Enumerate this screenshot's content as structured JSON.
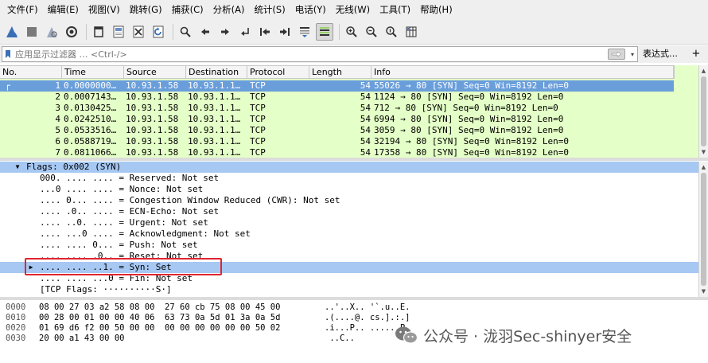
{
  "menu": [
    "文件(F)",
    "编辑(E)",
    "视图(V)",
    "跳转(G)",
    "捕获(C)",
    "分析(A)",
    "统计(S)",
    "电话(Y)",
    "无线(W)",
    "工具(T)",
    "帮助(H)"
  ],
  "toolbar": {
    "icons": [
      "shark-fin-start-icon",
      "stop-square-icon",
      "restart-fin-icon",
      "capture-options-gear-icon",
      "open-folder-icon",
      "save-file-icon",
      "close-file-icon",
      "reload-icon",
      "find-magnifier-icon",
      "go-back-arrow-icon",
      "go-forward-arrow-icon",
      "go-to-packet-icon",
      "go-first-packet-icon",
      "go-last-packet-icon",
      "autoscroll-icon",
      "colorize-icon",
      "zoom-in-icon",
      "zoom-out-icon",
      "zoom-normal-icon",
      "resize-columns-icon"
    ]
  },
  "filter": {
    "placeholder": "应用显示过滤器 … <Ctrl-/>",
    "expression_label": "表达式…",
    "plus_label": "+"
  },
  "packet_list": {
    "columns": [
      "No.",
      "Time",
      "Source",
      "Destination",
      "Protocol",
      "Length",
      "Info"
    ],
    "rows": [
      {
        "no": "1",
        "time": "0.0000000…",
        "src": "10.93.1.58",
        "dst": "10.93.1.1…",
        "proto": "TCP",
        "len": "54",
        "info": "55026 → 80 [SYN] Seq=0 Win=8192 Len=0"
      },
      {
        "no": "2",
        "time": "0.0007143…",
        "src": "10.93.1.58",
        "dst": "10.93.1.1…",
        "proto": "TCP",
        "len": "54",
        "info": "1124 → 80 [SYN] Seq=0 Win=8192 Len=0"
      },
      {
        "no": "3",
        "time": "0.0130425…",
        "src": "10.93.1.58",
        "dst": "10.93.1.1…",
        "proto": "TCP",
        "len": "54",
        "info": "712 → 80 [SYN] Seq=0 Win=8192 Len=0"
      },
      {
        "no": "4",
        "time": "0.0242510…",
        "src": "10.93.1.58",
        "dst": "10.93.1.1…",
        "proto": "TCP",
        "len": "54",
        "info": "6994 → 80 [SYN] Seq=0 Win=8192 Len=0"
      },
      {
        "no": "5",
        "time": "0.0533516…",
        "src": "10.93.1.58",
        "dst": "10.93.1.1…",
        "proto": "TCP",
        "len": "54",
        "info": "3059 → 80 [SYN] Seq=0 Win=8192 Len=0"
      },
      {
        "no": "6",
        "time": "0.0588719…",
        "src": "10.93.1.58",
        "dst": "10.93.1.1…",
        "proto": "TCP",
        "len": "54",
        "info": "32194 → 80 [SYN] Seq=0 Win=8192 Len=0"
      },
      {
        "no": "7",
        "time": "0.0811066…",
        "src": "10.93.1.58",
        "dst": "10.93.1.1…",
        "proto": "TCP",
        "len": "54",
        "info": "17358 → 80 [SYN] Seq=0 Win=8192 Len=0"
      }
    ]
  },
  "details": {
    "header": "Flags: 0x002 (SYN)",
    "lines": [
      "000. .... .... = Reserved: Not set",
      "...0 .... .... = Nonce: Not set",
      ".... 0... .... = Congestion Window Reduced (CWR): Not set",
      ".... .0.. .... = ECN-Echo: Not set",
      ".... ..0. .... = Urgent: Not set",
      ".... ...0 .... = Acknowledgment: Not set",
      ".... .... 0... = Push: Not set",
      ".... .... .0.. = Reset: Not set",
      ".... .... ..1. = Syn: Set",
      ".... .... ...0 = Fin: Not set",
      "[TCP Flags: ··········S·]"
    ]
  },
  "bytes": [
    {
      "offset": "0000",
      "hex": "08 00 27 03 a2 58 08 00  27 60 cb 75 08 00 45 00",
      "ascii": "..'..X.. '`.u..E."
    },
    {
      "offset": "0010",
      "hex": "00 28 00 01 00 00 40 06  63 73 0a 5d 01 3a 0a 5d",
      "ascii": ".(....@. cs.].:.]"
    },
    {
      "offset": "0020",
      "hex": "01 69 d6 f2 00 50 00 00  00 00 00 00 00 00 50 02",
      "ascii": ".i...P.. ......P."
    },
    {
      "offset": "0030",
      "hex": "20 00 a1 43 00 00",
      "ascii": " ..C.."
    }
  ],
  "watermark": {
    "text": "公众号 · 泷羽Sec-shinyer安全",
    "icon": "wechat-logo-icon"
  },
  "colors": {
    "selected_row": "#6a9edb",
    "row_bg": "#e4ffc7",
    "detail_highlight": "#a6c8f3",
    "annotation_box": "#e0252f"
  }
}
